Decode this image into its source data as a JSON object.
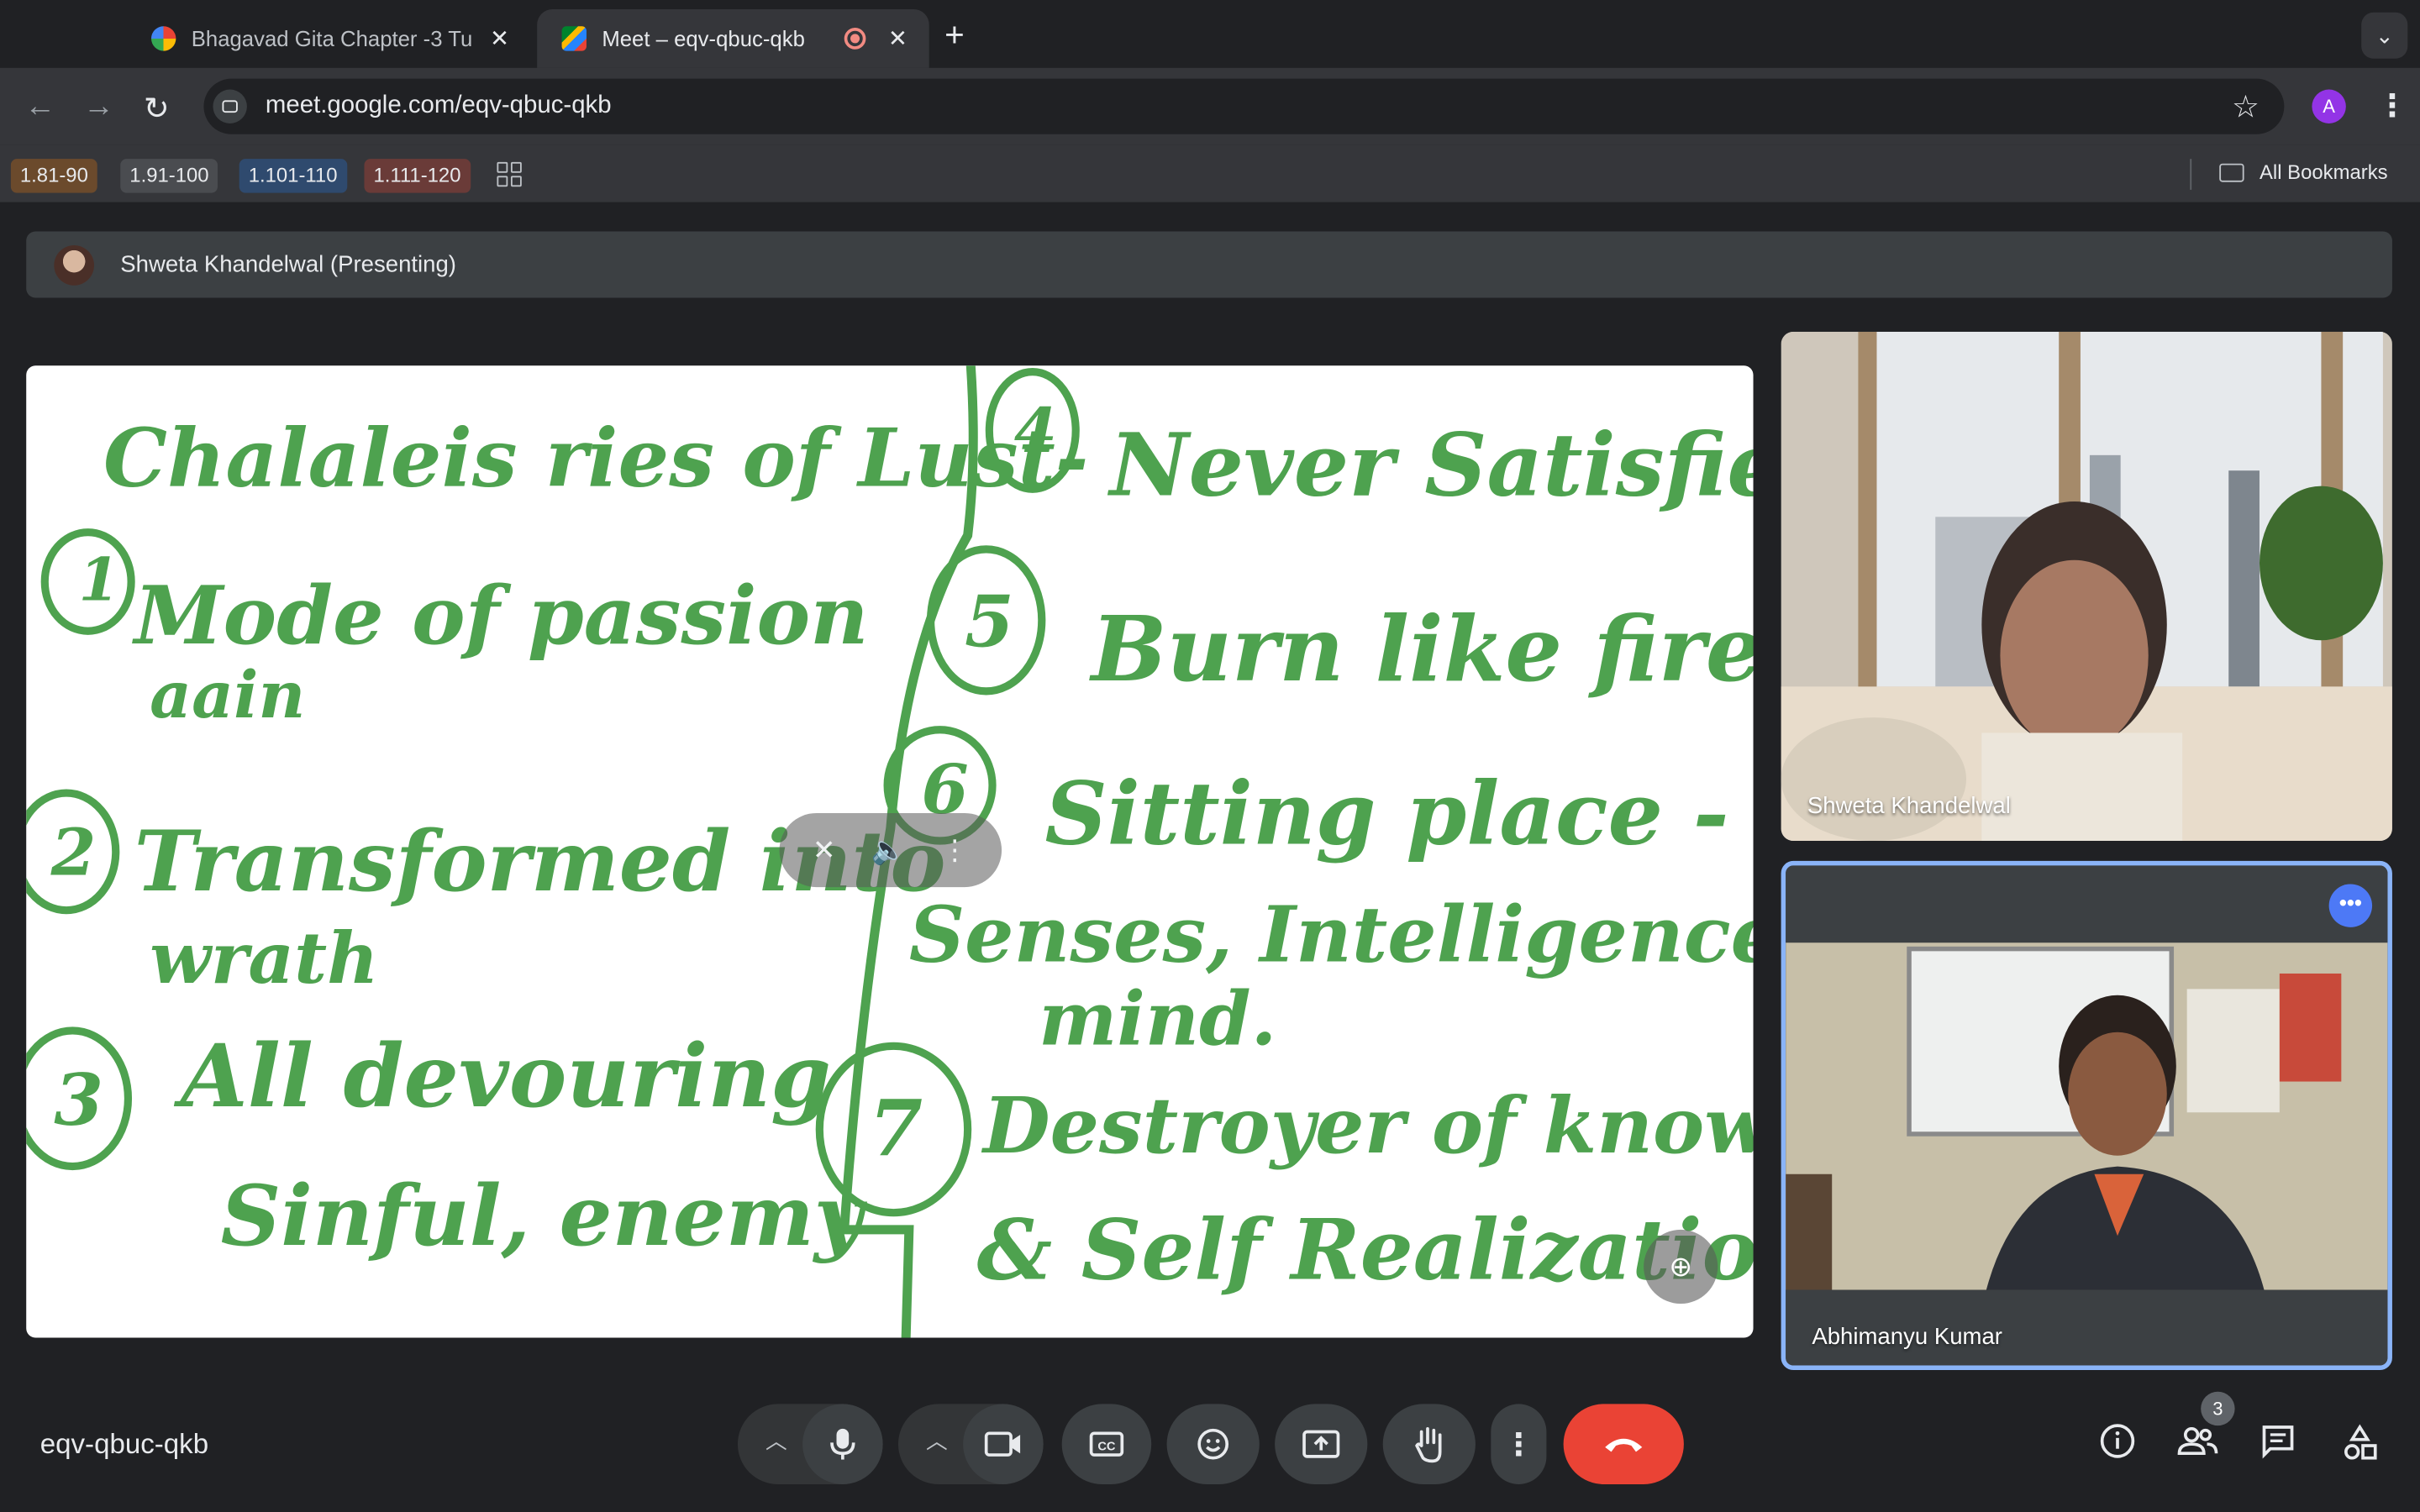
{
  "tabs": [
    {
      "title": "Bhagavad Gita Chapter -3 Tu",
      "close": "✕",
      "favicon": "google-favicon"
    },
    {
      "title": "Meet – eqv-qbuc-qkb",
      "close": "✕",
      "favicon": "meet-favicon"
    }
  ],
  "newtab": "+",
  "tabmenu": "⌄",
  "nav": {
    "back": "←",
    "forward": "→",
    "reload": "↻"
  },
  "omnibox": {
    "url": "meet.google.com/eqv-qbuc-qkb",
    "star": "☆"
  },
  "profile_initial": "A",
  "menu_icon": "⋮",
  "bookmarks": [
    "1.81-90",
    "1.91-100",
    "1.101-110",
    "1.111-120"
  ],
  "all_bookmarks": "All Bookmarks",
  "presenting_banner": "Shweta Khandelwal (Presenting)",
  "whiteboard_text": [
    "Chalaleis ries of Lust-",
    "Mode of passion",
    "aain",
    "Transformed into",
    "wrath",
    "All devouring",
    "Sinful, enemy",
    "Never Satisfied.",
    "Burn like fire.",
    "Sitting place -",
    "Senses, Intelligence,",
    "mind.",
    "Destroyer of knowledge",
    "& Self Realization"
  ],
  "whiteboard_numbers": [
    "1",
    "2",
    "3",
    "4",
    "5",
    "6",
    "7"
  ],
  "participants": [
    {
      "name": "Shweta Khandelwal"
    },
    {
      "name": "Abhimanyu Kumar"
    }
  ],
  "tile_more": "•••",
  "meeting_code": "eqv-qbuc-qkb",
  "participant_count": "3",
  "colors": {
    "ink": "#4ea24f",
    "end_call": "#ea4335",
    "active_tile_border": "#8ab4f8",
    "more_button": "#4d79f6"
  }
}
